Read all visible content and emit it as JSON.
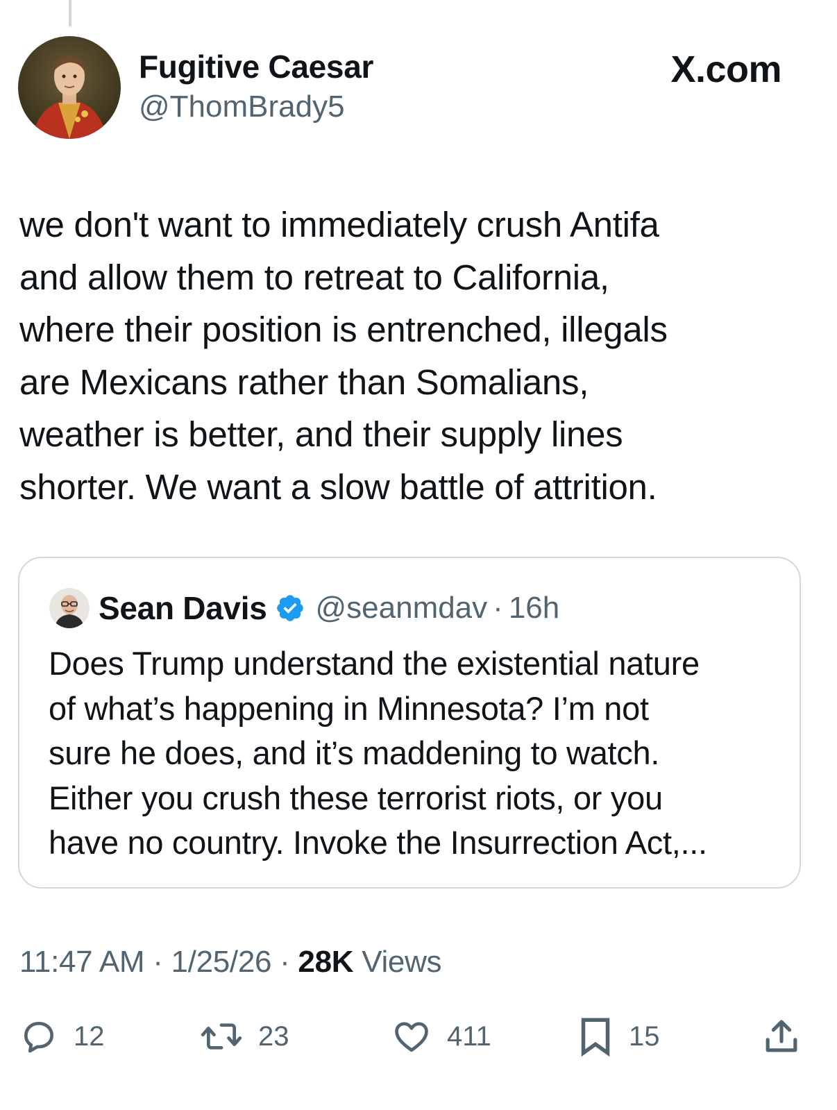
{
  "tweet": {
    "author_name": "Fugitive Caesar",
    "author_handle": "@ThomBrady5",
    "watermark": "X.com",
    "text_lines": [
      "we don't want to immediately crush Antifa",
      "and allow them to retreat to California,",
      "where their position is entrenched, illegals",
      "are Mexicans rather than Somalians,",
      "weather is better, and their supply lines",
      "shorter. We want a slow battle of attrition."
    ],
    "time": "11:47 AM",
    "date": "1/25/26",
    "views_count": "28K",
    "views_label": "Views",
    "separator": "·"
  },
  "quote": {
    "author_name": "Sean Davis",
    "author_handle": "@seanmdav",
    "separator": "·",
    "age": "16h",
    "verified_icon": "verified-badge-icon",
    "text_lines": [
      "Does Trump understand the existential nature",
      "of what’s happening in Minnesota? I’m not",
      "sure he does, and it’s maddening to watch.",
      "Either you crush these terrorist riots, or you",
      "have no country. Invoke the Insurrection Act,..."
    ]
  },
  "actions": {
    "replies": "12",
    "reposts": "23",
    "likes": "411",
    "bookmarks": "15"
  },
  "colors": {
    "text": "#0f1419",
    "secondary": "#536471",
    "border": "#cfd9de",
    "verified": "#1d9bf0"
  }
}
